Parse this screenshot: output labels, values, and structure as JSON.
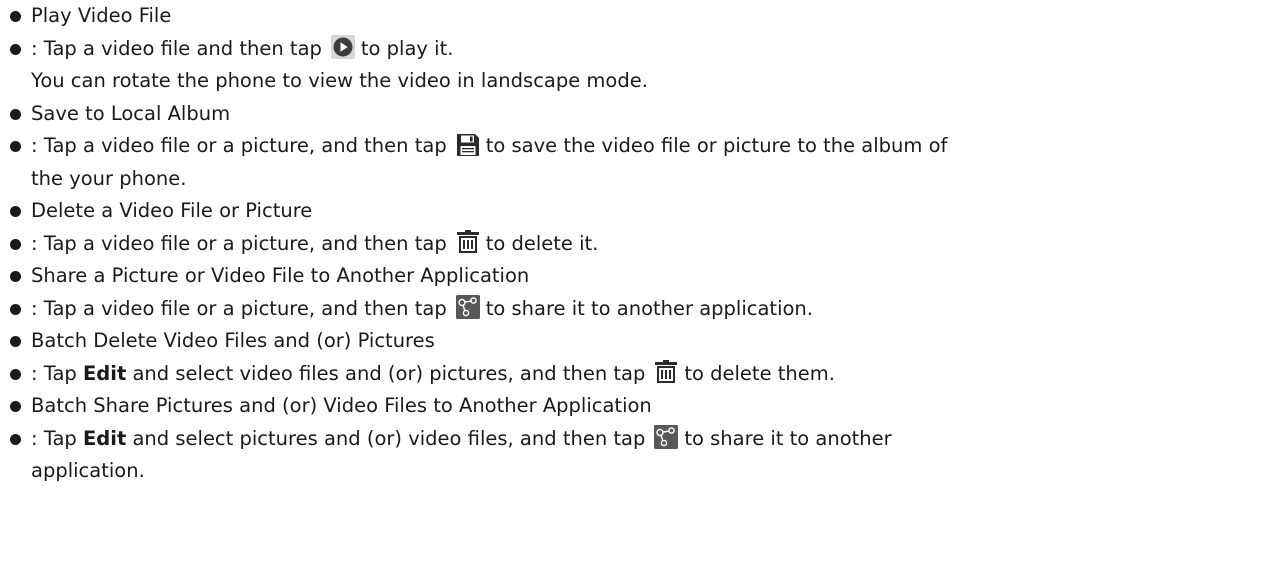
{
  "items": [
    {
      "type": "heading",
      "text": "Play Video File"
    },
    {
      "type": "desc",
      "lines": [
        {
          "pre": ": Tap a video file and then tap",
          "icon": "play-icon",
          "post": "to play it."
        },
        {
          "text": "You can rotate the phone to view the video in landscape mode."
        }
      ]
    },
    {
      "type": "heading",
      "text": "Save to Local Album"
    },
    {
      "type": "desc",
      "lines": [
        {
          "pre": ": Tap a video file or a picture, and then tap",
          "icon": "save-icon",
          "post": "to save the video file or picture to the album of"
        },
        {
          "text": "the your phone."
        }
      ]
    },
    {
      "type": "heading",
      "text": "Delete a Video File or Picture"
    },
    {
      "type": "desc",
      "lines": [
        {
          "pre": ": Tap a video file or a picture, and then tap",
          "icon": "trash-icon",
          "post": "to delete it."
        }
      ]
    },
    {
      "type": "heading",
      "text": "Share a Picture or Video File to Another Application"
    },
    {
      "type": "desc",
      "lines": [
        {
          "pre": ": Tap a video file or a picture, and then tap",
          "icon": "share-icon",
          "post": "to share it to another application."
        }
      ]
    },
    {
      "type": "heading",
      "text": "Batch Delete Video Files and (or) Pictures"
    },
    {
      "type": "desc",
      "lines": [
        {
          "pre_a": ": Tap ",
          "bold": "Edit",
          "pre_b": " and select video files and (or) pictures, and then tap",
          "icon": "trash-icon",
          "post": "to delete them."
        }
      ]
    },
    {
      "type": "heading",
      "text": "Batch Share Pictures and (or) Video Files to Another Application"
    },
    {
      "type": "desc",
      "lines": [
        {
          "pre_a": ": Tap ",
          "bold": "Edit",
          "pre_b": " and select pictures and (or) video files, and then tap",
          "icon": "share-icon",
          "post": "to share it to another"
        },
        {
          "text": "application."
        }
      ]
    }
  ]
}
